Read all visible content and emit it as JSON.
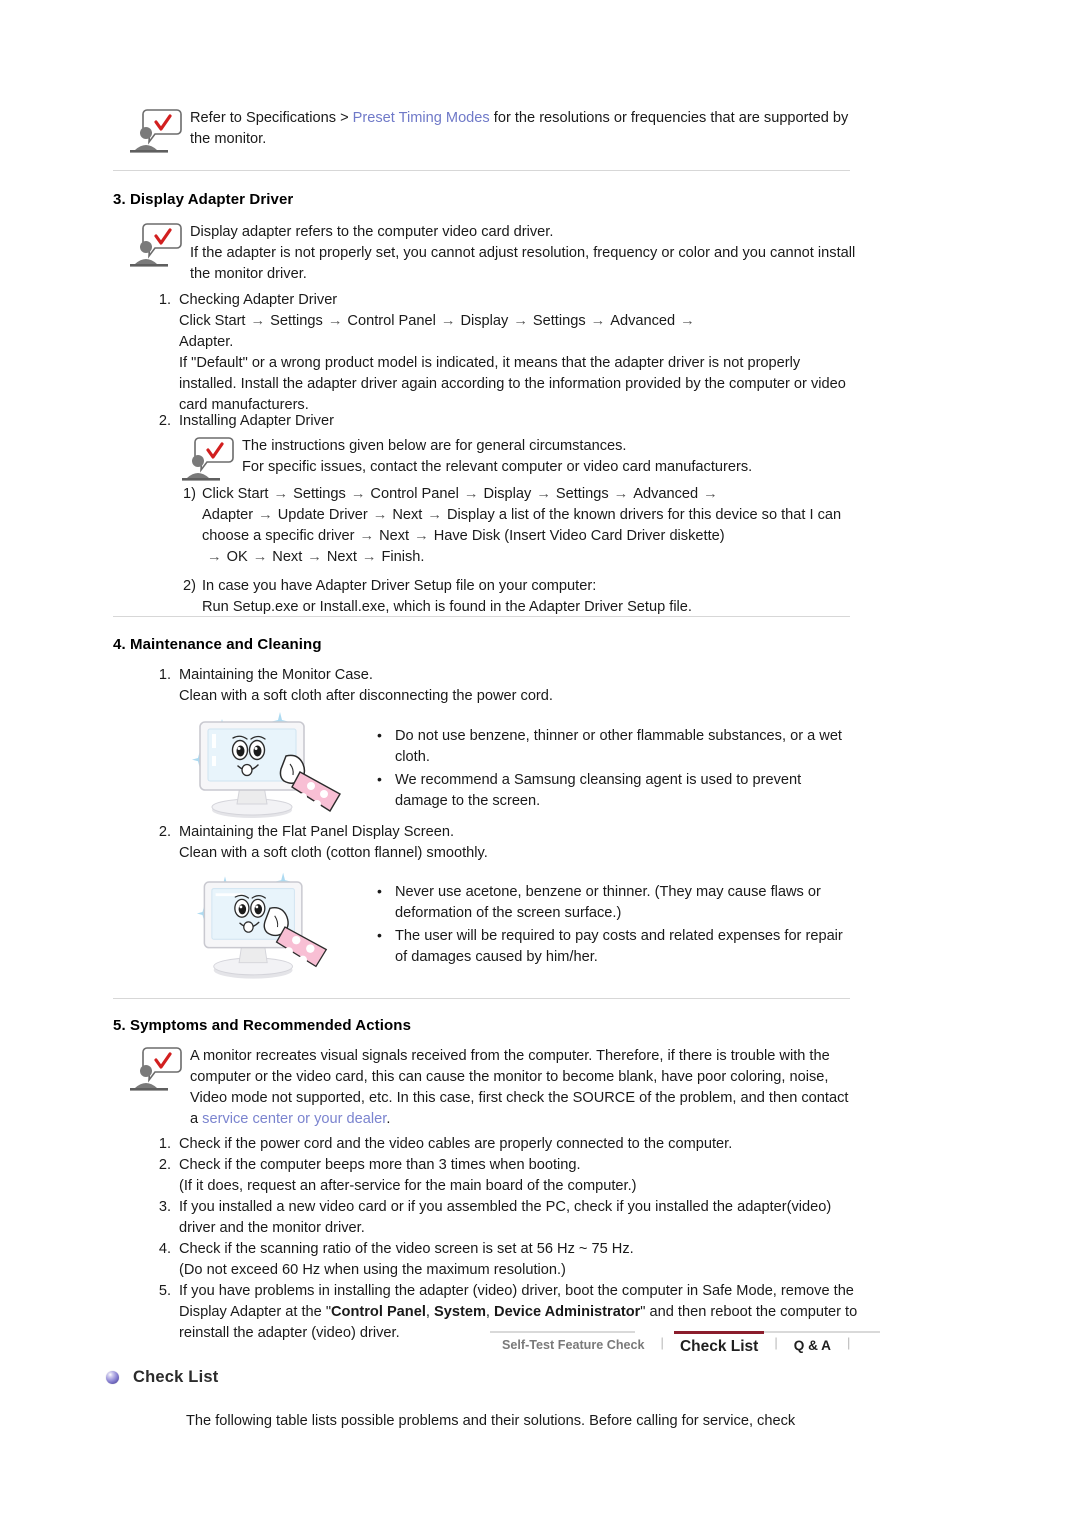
{
  "top_note": {
    "icon": "person-speech-check-icon",
    "text_before_link": "Refer to Specifications > ",
    "link": "Preset Timing Modes",
    "text_after_link": " for the resolutions or frequencies that are supported by the monitor."
  },
  "section3": {
    "title": "3. Display Adapter Driver",
    "note": {
      "icon": "person-speech-check-icon",
      "line1": "Display adapter refers to the computer video card driver.",
      "line2": "If the adapter is not properly set, you cannot adjust resolution, frequency or color and you cannot install the monitor driver."
    },
    "items": [
      {
        "num": "1.",
        "heading": "Checking Adapter Driver",
        "path": [
          "Click Start",
          "Settings",
          "Control Panel",
          "Display",
          "Settings",
          "Advanced",
          "Adapter."
        ],
        "body": "If \"Default\" or a wrong product model is indicated, it means that the adapter driver is not properly installed. Install the adapter driver again according to the information provided by the computer or video card manufacturers."
      },
      {
        "num": "2.",
        "heading": "Installing Adapter Driver",
        "note": {
          "icon": "person-speech-check-icon",
          "line1": "The instructions given below are for general circumstances.",
          "line2": "For specific issues, contact the relevant computer or video card manufacturers."
        },
        "substeps": [
          {
            "num": "1)",
            "path": [
              "Click Start",
              "Settings",
              "Control Panel",
              "Display",
              "Settings",
              "Advanced",
              "Adapter",
              "Update Driver",
              "Next",
              "Display a list of the known drivers for this device so that I can choose a specific driver",
              "Next",
              "Have Disk (Insert Video Card Driver diskette)",
              "OK",
              "Next",
              "Next",
              "Finish."
            ]
          },
          {
            "num": "2)",
            "line1": "In case you have Adapter Driver Setup file on your computer:",
            "line2": "Run Setup.exe or Install.exe, which is found in the Adapter Driver Setup file."
          }
        ]
      }
    ]
  },
  "section4": {
    "title": "4. Maintenance and Cleaning",
    "items": [
      {
        "num": "1.",
        "line1": "Maintaining the Monitor Case.",
        "line2": "Clean with a soft cloth after disconnecting the power cord.",
        "figure": "monitor-cleaning-illustration",
        "bullets": [
          "Do not use benzene, thinner or other flammable substances, or a wet cloth.",
          "We recommend a Samsung cleansing agent is used to prevent damage to the screen."
        ]
      },
      {
        "num": "2.",
        "line1": "Maintaining the Flat Panel Display Screen.",
        "line2": "Clean with a soft cloth (cotton flannel) smoothly.",
        "figure": "monitor-cleaning-illustration",
        "bullets": [
          "Never use acetone, benzene or thinner. (They may cause flaws or deformation of the screen surface.)",
          "The user will be required to pay costs and related expenses for repair of damages caused by him/her."
        ]
      }
    ]
  },
  "section5": {
    "title": "5. Symptoms and Recommended Actions",
    "note": {
      "icon": "person-speech-check-icon",
      "text_before_link": "A monitor recreates visual signals received from the computer. Therefore, if there is trouble with the computer or the video card, this can cause the monitor to become blank, have poor coloring, noise, Video mode not supported, etc. In this case, first check the SOURCE of the problem, and then contact a ",
      "link": "service center or your dealer",
      "text_after_link": "."
    },
    "items": [
      {
        "num": "1.",
        "lines": [
          "Check if the power cord and the video cables are properly connected to the computer."
        ]
      },
      {
        "num": "2.",
        "lines": [
          "Check if the computer beeps more than 3 times when booting.",
          "(If it does, request an after-service for the main board of the computer.)"
        ]
      },
      {
        "num": "3.",
        "lines": [
          "If you installed a new video card or if you assembled the PC, check if you installed the adapter(video) driver and the monitor driver."
        ]
      },
      {
        "num": "4.",
        "lines": [
          "Check if the scanning ratio of the video screen is set at 56 Hz ~ 75 Hz.",
          "(Do not exceed 60 Hz when using the maximum resolution.)"
        ]
      },
      {
        "num": "5.",
        "rich": {
          "part1": "If you have problems in installing the adapter (video) driver, boot the computer in Safe Mode, remove the Display Adapter at the \"",
          "bold1": "Control Panel",
          "sep1": ", ",
          "bold2": "System",
          "sep2": ", ",
          "bold3": "Device Administrator",
          "part2": "\" and then reboot the computer to reinstall the adapter (video) driver."
        }
      }
    ]
  },
  "footer_nav": {
    "tabs": [
      {
        "label": "Self-Test Feature Check",
        "active": false
      },
      {
        "label": "Check List",
        "active": true
      },
      {
        "label": "Q & A",
        "active": false
      }
    ],
    "separator": "|",
    "active_indicator_color": "#8b1d2c"
  },
  "check_list": {
    "bullet": "purple-sphere-bullet",
    "title": "Check List",
    "intro": "The following table lists possible problems and their solutions. Before calling for service, check"
  }
}
